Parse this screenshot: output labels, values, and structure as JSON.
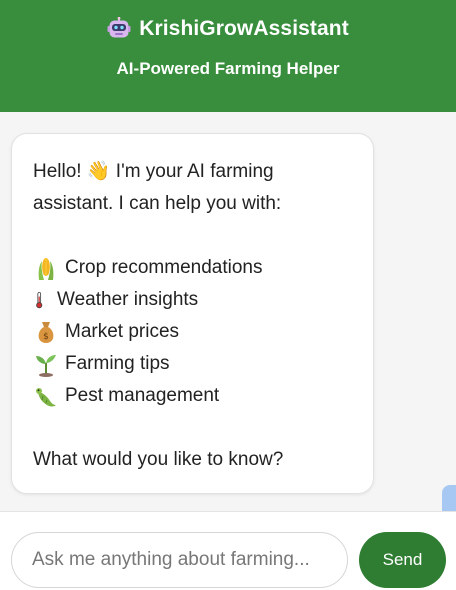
{
  "colors": {
    "header_bg": "#388e3c",
    "send_bg": "#2e7d32",
    "side_tab": "#a7c8f2"
  },
  "header": {
    "icon": "robot-icon",
    "title": "KrishiGrowAssistant",
    "subtitle": "AI-Powered Farming Helper"
  },
  "message": {
    "greeting": "Hello! 👋 I'm your AI farming assistant. I can help you with:",
    "items": [
      {
        "icon": "corn-icon",
        "label": "Crop recommendations"
      },
      {
        "icon": "thermometer-icon",
        "label": "Weather insights"
      },
      {
        "icon": "money-bag-icon",
        "label": "Market prices"
      },
      {
        "icon": "seedling-icon",
        "label": "Farming tips"
      },
      {
        "icon": "bug-icon",
        "label": "Pest management"
      }
    ],
    "closing": "What would you like to know?"
  },
  "input": {
    "placeholder": "Ask me anything about farming...",
    "value": ""
  },
  "send": {
    "label": "Send"
  }
}
